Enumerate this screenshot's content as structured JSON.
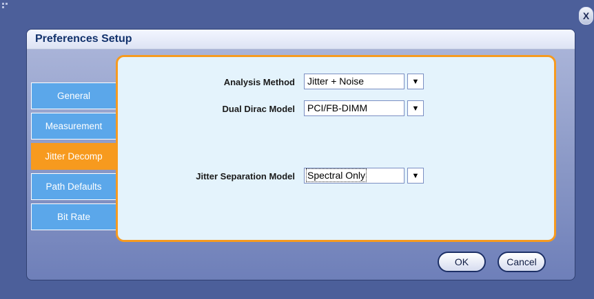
{
  "window": {
    "close_label": "X"
  },
  "dialog": {
    "title": "Preferences Setup"
  },
  "tabs": [
    {
      "label": "General",
      "active": false
    },
    {
      "label": "Measurement",
      "active": false
    },
    {
      "label": "Jitter Decomp",
      "active": true
    },
    {
      "label": "Path Defaults",
      "active": false
    },
    {
      "label": "Bit Rate",
      "active": false
    }
  ],
  "fields": {
    "analysis_method": {
      "label": "Analysis Method",
      "value": "Jitter + Noise"
    },
    "dual_dirac_model": {
      "label": "Dual Dirac Model",
      "value": "PCI/FB-DIMM"
    },
    "jitter_separation_model": {
      "label": "Jitter Separation Model",
      "value": "Spectral Only"
    }
  },
  "dropdown_arrow": "▼",
  "buttons": {
    "ok": "OK",
    "cancel": "Cancel"
  },
  "colors": {
    "active_tab": "#f79a1e",
    "inactive_tab": "#5ba7ea",
    "panel_background": "#e4f3fc",
    "title_text": "#12326c"
  }
}
